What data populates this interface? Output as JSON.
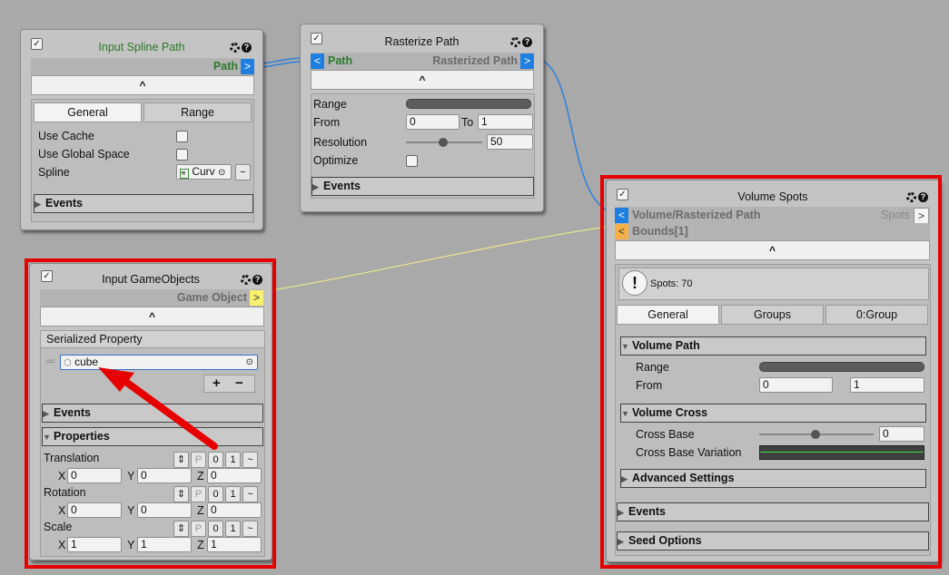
{
  "nodes": {
    "spline": {
      "title": "Input Spline Path",
      "out_port": "Path",
      "tabs": [
        "General",
        "Range"
      ],
      "fields": {
        "use_cache": "Use Cache",
        "use_global": "Use Global Space",
        "spline": "Spline",
        "spline_value": "Curv"
      },
      "events": "Events"
    },
    "raster": {
      "title": "Rasterize Path",
      "in_port": "Path",
      "out_port": "Rasterized Path",
      "range": "Range",
      "from": "From",
      "from_value": "0",
      "to": "To",
      "to_value": "1",
      "resolution": "Resolution",
      "resolution_value": "50",
      "optimize": "Optimize",
      "events": "Events"
    },
    "gameobjects": {
      "title": "Input GameObjects",
      "out_port": "Game Object",
      "serialized": "Serialized Property",
      "item": "cube",
      "events": "Events",
      "properties": "Properties",
      "translation": "Translation",
      "rotation": "Rotation",
      "scale": "Scale",
      "x": "X",
      "y": "Y",
      "z": "Z",
      "p_label": "P",
      "zero": "0",
      "one": "1",
      "tilde": "~",
      "plus": "+",
      "minus": "−",
      "t_values": [
        "0",
        "0",
        "0"
      ],
      "r_values": [
        "0",
        "0",
        "0"
      ],
      "s_values": [
        "1",
        "1",
        "1"
      ]
    },
    "volume": {
      "title": "Volume Spots",
      "in_port": "Volume/Rasterized Path",
      "out_port": "Spots",
      "in_port2": "Bounds[1]",
      "info": "Spots: 70",
      "tabs": [
        "General",
        "Groups",
        "0:Group"
      ],
      "volume_path": "Volume Path",
      "range": "Range",
      "from": "From",
      "from_value": "0",
      "to_value": "1",
      "volume_cross": "Volume Cross",
      "cross_base": "Cross Base",
      "cross_base_value": "0",
      "cross_var": "Cross Base Variation",
      "advanced": "Advanced Settings",
      "events": "Events",
      "seed": "Seed Options"
    }
  },
  "colors": {
    "accent_blue": "#1e7fe0",
    "accent_yellow": "#f7f06e",
    "accent_orange": "#f5b04a",
    "highlight_red": "#e60000"
  }
}
